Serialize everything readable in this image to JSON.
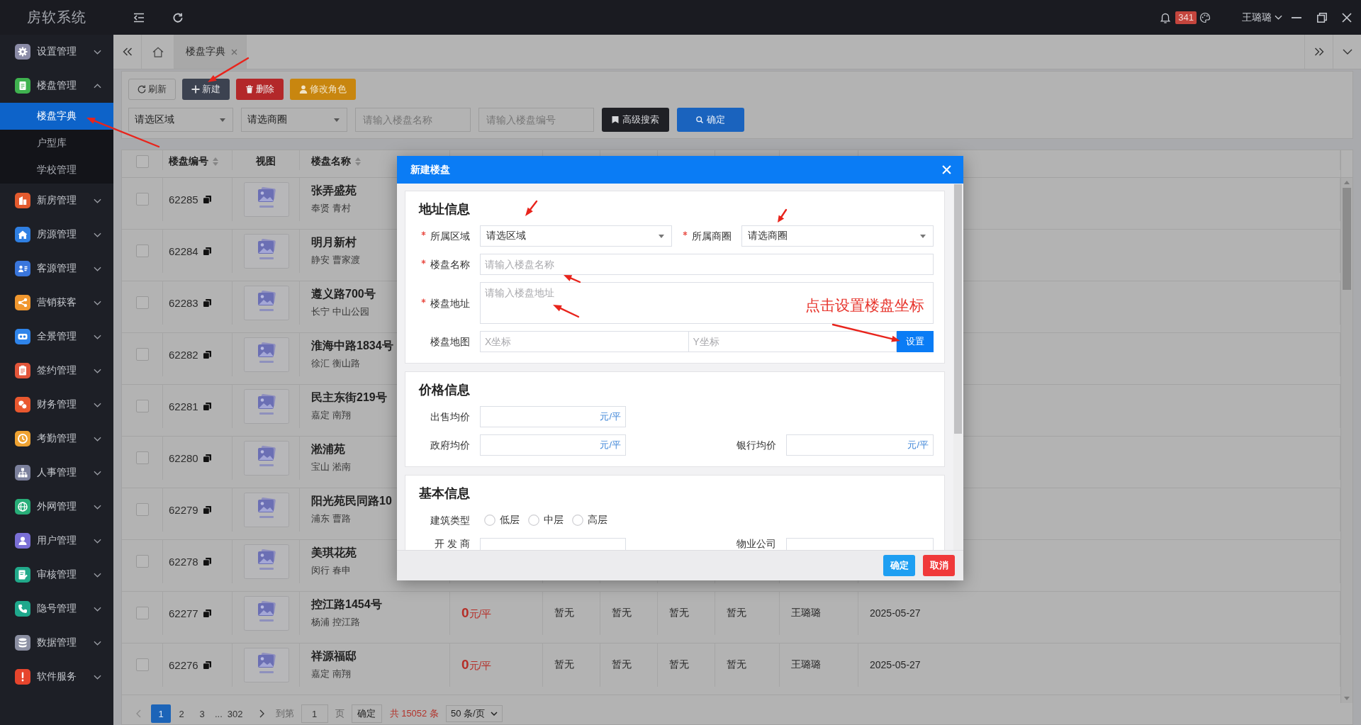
{
  "app": {
    "logo": "房软系统"
  },
  "topbar": {
    "notifications": "341",
    "user": "王璐璐"
  },
  "sidebar": {
    "items": [
      {
        "label": "设置管理",
        "color": "#8a8ba6",
        "expanded": false
      },
      {
        "label": "楼盘管理",
        "color": "#3fb24f",
        "expanded": true,
        "children": [
          {
            "label": "楼盘字典",
            "selected": true
          },
          {
            "label": "户型库",
            "selected": false
          },
          {
            "label": "学校管理",
            "selected": false
          }
        ]
      },
      {
        "label": "新房管理",
        "color": "#e35a2e",
        "expanded": false
      },
      {
        "label": "房源管理",
        "color": "#2f7fe2",
        "expanded": false
      },
      {
        "label": "客源管理",
        "color": "#3a76dc",
        "expanded": false
      },
      {
        "label": "营销获客",
        "color": "#f0972f",
        "expanded": false
      },
      {
        "label": "全景管理",
        "color": "#2f84ea",
        "expanded": false
      },
      {
        "label": "签约管理",
        "color": "#e2553a",
        "expanded": false
      },
      {
        "label": "财务管理",
        "color": "#e9582f",
        "expanded": false
      },
      {
        "label": "考勤管理",
        "color": "#eea232",
        "expanded": false
      },
      {
        "label": "人事管理",
        "color": "#7b809c",
        "expanded": false
      },
      {
        "label": "外网管理",
        "color": "#28ad78",
        "expanded": false
      },
      {
        "label": "用户管理",
        "color": "#7a6fd6",
        "expanded": false
      },
      {
        "label": "审核管理",
        "color": "#21a98a",
        "expanded": false
      },
      {
        "label": "隐号管理",
        "color": "#1fa88c",
        "expanded": false
      },
      {
        "label": "数据管理",
        "color": "#8b8fa2",
        "expanded": false
      },
      {
        "label": "软件服务",
        "color": "#e6452d",
        "expanded": false
      }
    ]
  },
  "tabs": [
    {
      "label": "楼盘字典",
      "selected": true
    }
  ],
  "toolbar": {
    "buttons": [
      {
        "label": "刷新",
        "kind": "refresh"
      },
      {
        "label": "新建",
        "kind": "create"
      },
      {
        "label": "删除",
        "kind": "delete"
      },
      {
        "label": "修改角色",
        "kind": "role"
      }
    ],
    "filters": {
      "area": "请选区域",
      "business_district": "请选商圈",
      "name_field": {
        "placeholder": "请输入楼盘名称"
      },
      "code_field": {
        "placeholder": "请输入楼盘编号"
      },
      "advanced_search": "高级搜索",
      "confirm": "确定"
    }
  },
  "table": {
    "all_checked": false,
    "columns": [
      {
        "label": "楼盘编号",
        "sortable": true
      },
      {
        "label": "视图",
        "sortable": false
      },
      {
        "label": "楼盘名称",
        "sortable": true
      }
    ],
    "rows": [
      {
        "checked": false,
        "code": "62285",
        "name": "张弄盛苑",
        "location": "奉贤 青村"
      },
      {
        "checked": false,
        "code": "62284",
        "name": "明月新村",
        "location": "静安 曹家渡"
      },
      {
        "checked": false,
        "code": "62283",
        "name": "遵义路700号",
        "location": "长宁 中山公园"
      },
      {
        "checked": false,
        "code": "62282",
        "name": "淮海中路1834号",
        "location": "徐汇 衡山路"
      },
      {
        "checked": false,
        "code": "62281",
        "name": "民主东街219号",
        "location": "嘉定 南翔"
      },
      {
        "checked": false,
        "code": "62280",
        "name": "淞浦苑",
        "location": "宝山 淞南"
      },
      {
        "checked": false,
        "code": "62279",
        "name": "阳光苑民同路10",
        "location": "浦东 曹路"
      },
      {
        "checked": false,
        "code": "62278",
        "name": "美琪花苑",
        "location": "闵行 春申"
      },
      {
        "checked": false,
        "code": "62277",
        "name": "控江路1454号",
        "location": "杨浦 控江路",
        "price": {
          "value": "0",
          "unit": "元/平"
        },
        "cells": [
          "暂无",
          "暂无",
          "暂无",
          "暂无",
          "王璐璐",
          "2025-05-27"
        ]
      },
      {
        "checked": false,
        "code": "62276",
        "name": "祥源福邸",
        "location": "嘉定 南翔",
        "price": {
          "value": "0",
          "unit": "元/平"
        },
        "cells": [
          "暂无",
          "暂无",
          "暂无",
          "暂无",
          "王璐璐",
          "2025-05-27"
        ]
      }
    ]
  },
  "pagination": {
    "pages": [
      {
        "label": "1",
        "selected": true
      },
      {
        "label": "2",
        "selected": false
      },
      {
        "label": "3",
        "selected": false
      }
    ],
    "ellipsis": "...",
    "last_page": {
      "label": "302",
      "selected": false
    },
    "goto_label": "到第",
    "goto_field": {
      "value": "1"
    },
    "page_label": "页",
    "goto_button": "确定",
    "total": "共 15052 条",
    "page_size": "50 条/页"
  },
  "modal": {
    "title": "新建楼盘",
    "sections": [
      {
        "title": "地址信息",
        "rows": [
          {
            "fields": [
              {
                "kind": "select",
                "label": "所属区域",
                "required": true,
                "value": "请选区域"
              },
              {
                "kind": "select",
                "label": "所属商圈",
                "required": true,
                "value": "请选商圈"
              }
            ]
          },
          {
            "fields": [
              {
                "kind": "input",
                "label": "楼盘名称",
                "required": true,
                "placeholder": "请输入楼盘名称"
              }
            ]
          },
          {
            "fields": [
              {
                "kind": "textarea",
                "label": "楼盘地址",
                "required": true,
                "placeholder": "请输入楼盘地址"
              }
            ]
          },
          {
            "fields": [
              {
                "kind": "coordinates",
                "label": "楼盘地图",
                "required": false,
                "x_field": {
                  "placeholder": "X坐标"
                },
                "y_field": {
                  "placeholder": "Y坐标"
                },
                "button": "设置"
              }
            ]
          }
        ]
      },
      {
        "title": "价格信息",
        "rows": [
          {
            "fields": [
              {
                "kind": "unit_input",
                "label": "出售均价",
                "required": false,
                "unit": "元/平"
              }
            ]
          },
          {
            "fields": [
              {
                "kind": "unit_input",
                "label": "政府均价",
                "required": false,
                "unit": "元/平"
              },
              {
                "kind": "unit_input",
                "label": "银行均价",
                "required": false,
                "unit": "元/平"
              }
            ]
          }
        ]
      },
      {
        "title": "基本信息",
        "rows": [
          {
            "fields": [
              {
                "kind": "radio",
                "label": "建筑类型",
                "required": false,
                "options": [
                  {
                    "label": "低层",
                    "selected": false
                  },
                  {
                    "label": "中层",
                    "selected": false
                  },
                  {
                    "label": "高层",
                    "selected": false
                  }
                ]
              }
            ]
          },
          {
            "fields": [
              {
                "kind": "short_input",
                "label": "开 发 商",
                "required": false
              },
              {
                "kind": "short_input",
                "label": "物业公司",
                "required": false
              }
            ]
          }
        ]
      }
    ],
    "buttons": [
      {
        "label": "确定",
        "kind": "confirm"
      },
      {
        "label": "取消",
        "kind": "cancel"
      }
    ]
  },
  "annotation": {
    "text": "点击设置楼盘坐标"
  }
}
